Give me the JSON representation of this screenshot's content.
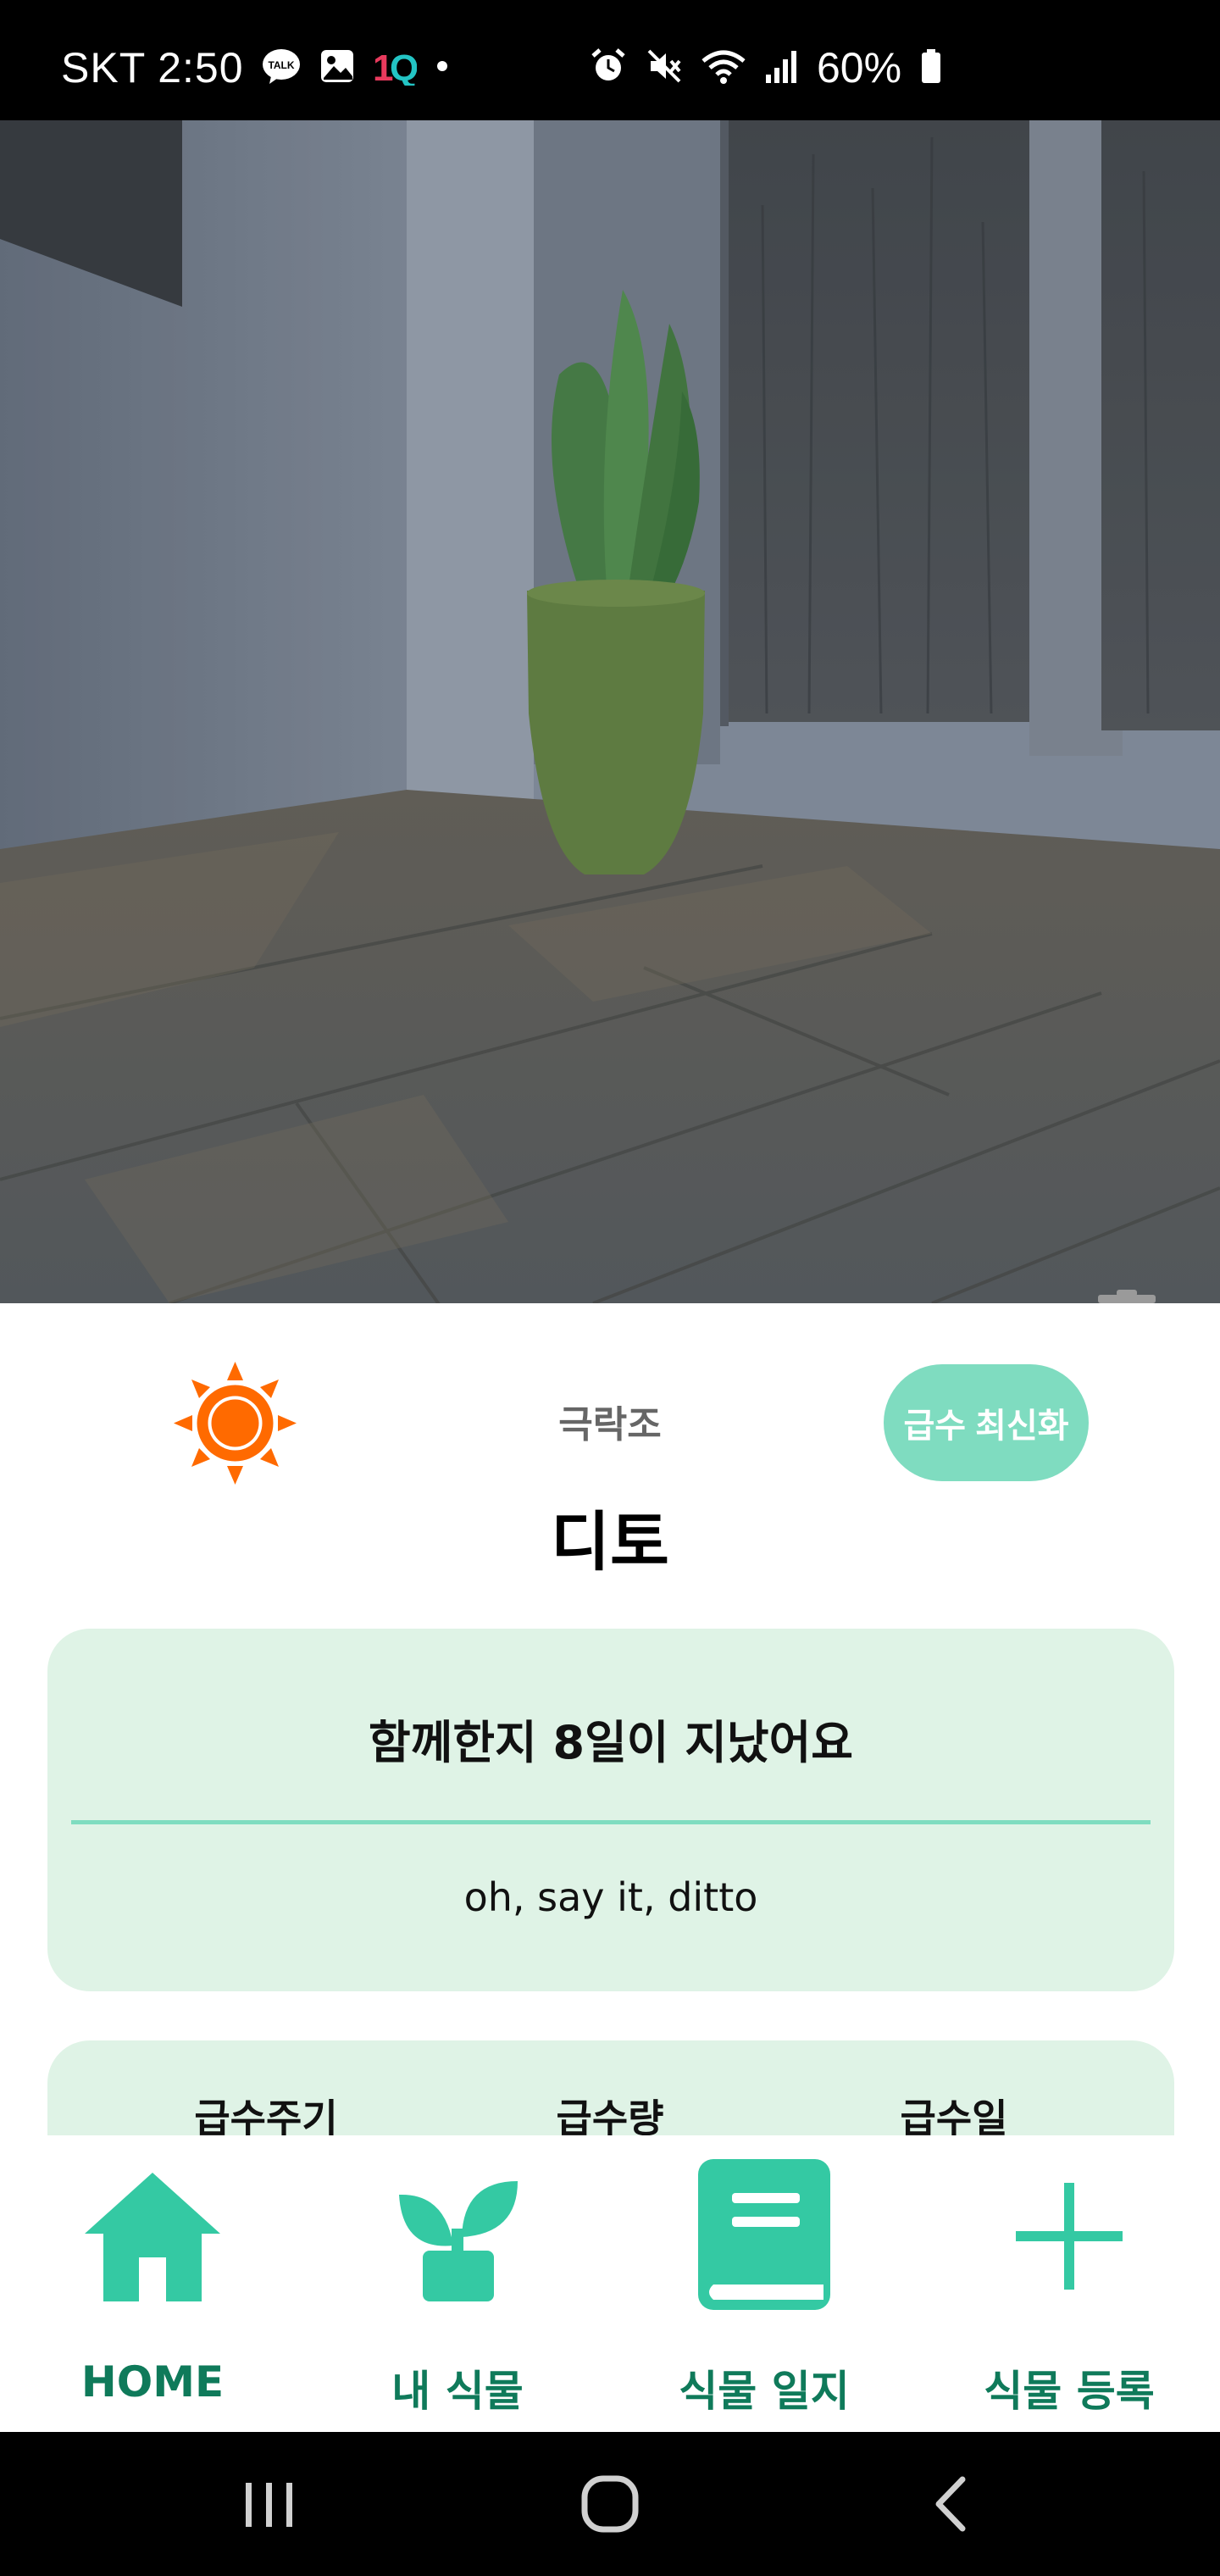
{
  "status_bar": {
    "carrier_time": "SKT 2:50",
    "battery_percent": "60%"
  },
  "header": {
    "species": "극락조",
    "plant_name": "디토",
    "refresh_button": "급수 최신화"
  },
  "days_card": {
    "title": "함께한지 8일이 지났어요",
    "quote": "oh, say it, ditto"
  },
  "watering_card": {
    "headers": [
      "급수주기",
      "급수량",
      "급수일"
    ]
  },
  "bottom_nav": {
    "items": [
      {
        "label": "HOME",
        "icon": "home-icon"
      },
      {
        "label": "내 식물",
        "icon": "sprout-icon"
      },
      {
        "label": "식물 일지",
        "icon": "journal-icon"
      },
      {
        "label": "식물 등록",
        "icon": "plus-icon"
      }
    ]
  },
  "colors": {
    "accent": "#34c9a3",
    "accent_light": "#7fdcc0",
    "card_bg": "#dff3e6",
    "nav_label": "#0f7a5a",
    "sun": "#ff6a00"
  }
}
